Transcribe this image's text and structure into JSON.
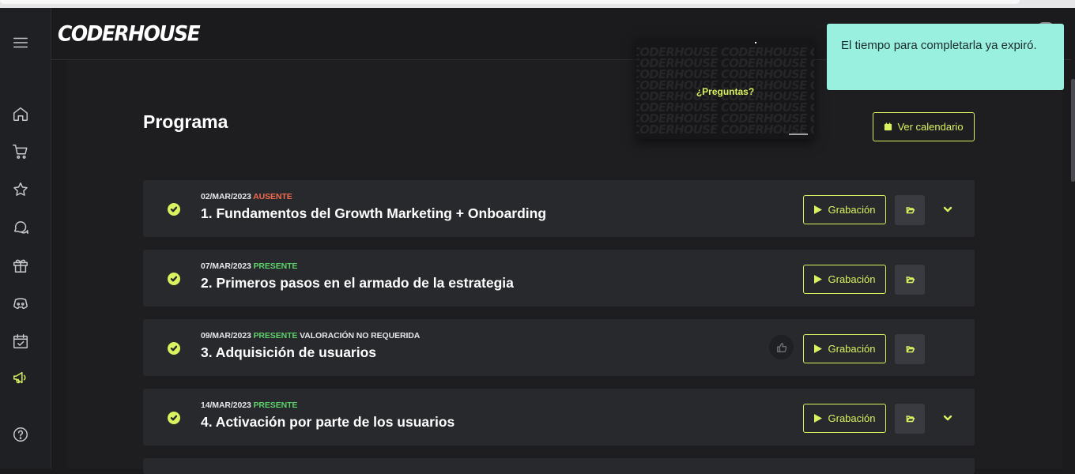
{
  "brand": {
    "logo_text": "CODERHOUSE"
  },
  "sidebar": {
    "items": [
      {
        "name": "menu-icon"
      },
      {
        "name": "home-icon"
      },
      {
        "name": "cart-icon"
      },
      {
        "name": "star-icon"
      },
      {
        "name": "chat-icon"
      },
      {
        "name": "gift-icon"
      },
      {
        "name": "discord-icon"
      },
      {
        "name": "calendar-check-icon"
      },
      {
        "name": "megaphone-icon"
      },
      {
        "name": "help-icon"
      }
    ]
  },
  "page": {
    "title": "Programa",
    "calendar_button": "Ver calendario"
  },
  "video_preview": {
    "background_text": "CODERHOUSE CODERHOUSE CODERHOUSE",
    "overlay_text": "¿Preguntas?"
  },
  "toast": {
    "message": "El tiempo para completarla ya expiró."
  },
  "classes": [
    {
      "date": "02/MAR/2023",
      "status": "AUSENTE",
      "status_color": "#f26b4f",
      "extra": "",
      "title": "1. Fundamentos del Growth Marketing + Onboarding",
      "record_label": "Grabación",
      "has_like": false,
      "has_chevron": true
    },
    {
      "date": "07/MAR/2023",
      "status": "PRESENTE",
      "status_color": "#5ed16a",
      "extra": "",
      "title": "2. Primeros pasos en el armado de la estrategia",
      "record_label": "Grabación",
      "has_like": false,
      "has_chevron": false
    },
    {
      "date": "09/MAR/2023",
      "status": "PRESENTE",
      "status_color": "#5ed16a",
      "extra": "VALORACIÓN NO REQUERIDA",
      "title": "3. Adquisición de usuarios",
      "record_label": "Grabación",
      "has_like": true,
      "has_chevron": false
    },
    {
      "date": "14/MAR/2023",
      "status": "PRESENTE",
      "status_color": "#5ed16a",
      "extra": "",
      "title": "4. Activación por parte de los usuarios",
      "record_label": "Grabación",
      "has_like": false,
      "has_chevron": true
    }
  ],
  "colors": {
    "accent": "#d9f25f",
    "toast_bg": "#99f0de",
    "card_bg": "#28292d",
    "status_absent": "#f26b4f",
    "status_present": "#5ed16a"
  }
}
